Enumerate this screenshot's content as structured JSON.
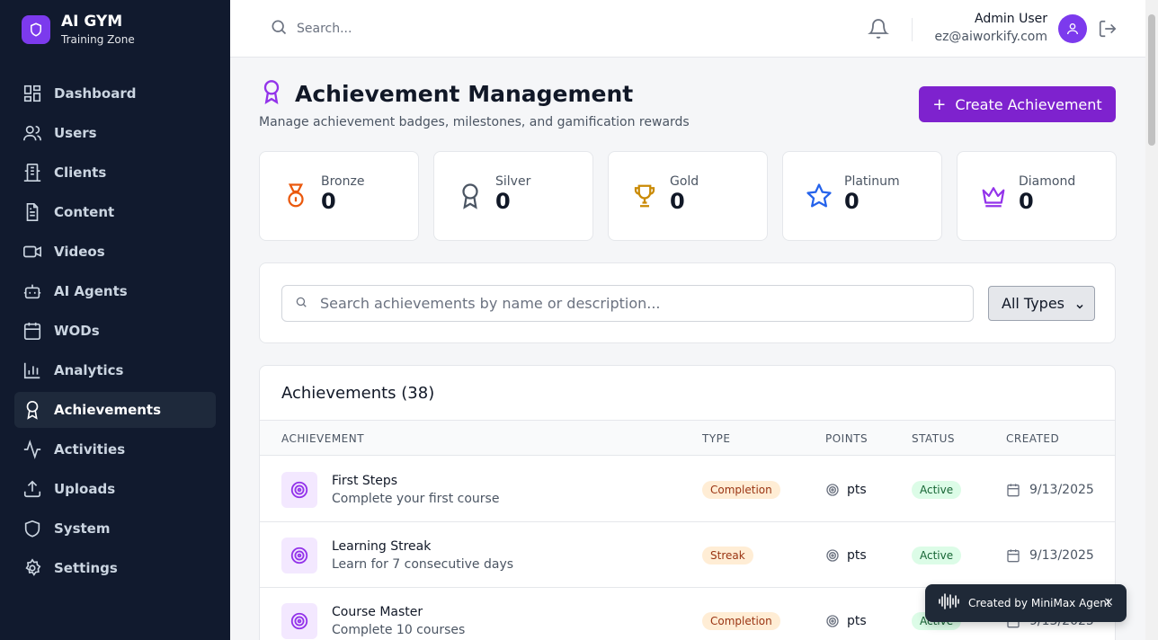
{
  "brand": {
    "title": "AI GYM",
    "subtitle": "Training Zone",
    "logo_icon": "shield-icon",
    "accent": "#7c3aed"
  },
  "sidebar": {
    "items": [
      {
        "label": "Dashboard",
        "icon": "dashboard-icon",
        "active": false
      },
      {
        "label": "Users",
        "icon": "users-icon",
        "active": false
      },
      {
        "label": "Clients",
        "icon": "clients-icon",
        "active": false
      },
      {
        "label": "Content",
        "icon": "document-icon",
        "active": false
      },
      {
        "label": "Videos",
        "icon": "video-icon",
        "active": false
      },
      {
        "label": "AI Agents",
        "icon": "bot-icon",
        "active": false
      },
      {
        "label": "WODs",
        "icon": "calendar-icon",
        "active": false
      },
      {
        "label": "Analytics",
        "icon": "bar-chart-icon",
        "active": false
      },
      {
        "label": "Achievements",
        "icon": "award-icon",
        "active": true
      },
      {
        "label": "Activities",
        "icon": "activity-icon",
        "active": false
      },
      {
        "label": "Uploads",
        "icon": "upload-icon",
        "active": false
      },
      {
        "label": "System",
        "icon": "shield-icon",
        "active": false
      },
      {
        "label": "Settings",
        "icon": "gear-icon",
        "active": false
      }
    ]
  },
  "header": {
    "search_placeholder": "Search...",
    "user_name": "Admin User",
    "user_email": "ez@aiworkify.com"
  },
  "page": {
    "title": "Achievement Management",
    "subtitle": "Manage achievement badges, milestones, and gamification rewards",
    "create_label": "Create Achievement"
  },
  "tiers": [
    {
      "name": "Bronze",
      "count": "0",
      "color": "#ea580c"
    },
    {
      "name": "Silver",
      "count": "0",
      "color": "#4b5563"
    },
    {
      "name": "Gold",
      "count": "0",
      "color": "#ca8a04"
    },
    {
      "name": "Platinum",
      "count": "0",
      "color": "#2563eb"
    },
    {
      "name": "Diamond",
      "count": "0",
      "color": "#9333ea"
    }
  ],
  "filters": {
    "search_placeholder": "Search achievements by name or description...",
    "type_selected": "All Types"
  },
  "table": {
    "title": "Achievements (38)",
    "columns": [
      "ACHIEVEMENT",
      "TYPE",
      "POINTS",
      "STATUS",
      "CREATED"
    ],
    "rows": [
      {
        "name": "First Steps",
        "description": "Complete your first course",
        "type": "Completion",
        "points": "pts",
        "status": "Active",
        "created": "9/13/2025"
      },
      {
        "name": "Learning Streak",
        "description": "Learn for 7 consecutive days",
        "type": "Streak",
        "points": "pts",
        "status": "Active",
        "created": "9/13/2025"
      },
      {
        "name": "Course Master",
        "description": "Complete 10 courses",
        "type": "Completion",
        "points": "pts",
        "status": "Active",
        "created": "9/13/2025"
      }
    ]
  },
  "toast": {
    "text": "Created by MiniMax Agent",
    "close": "×"
  }
}
